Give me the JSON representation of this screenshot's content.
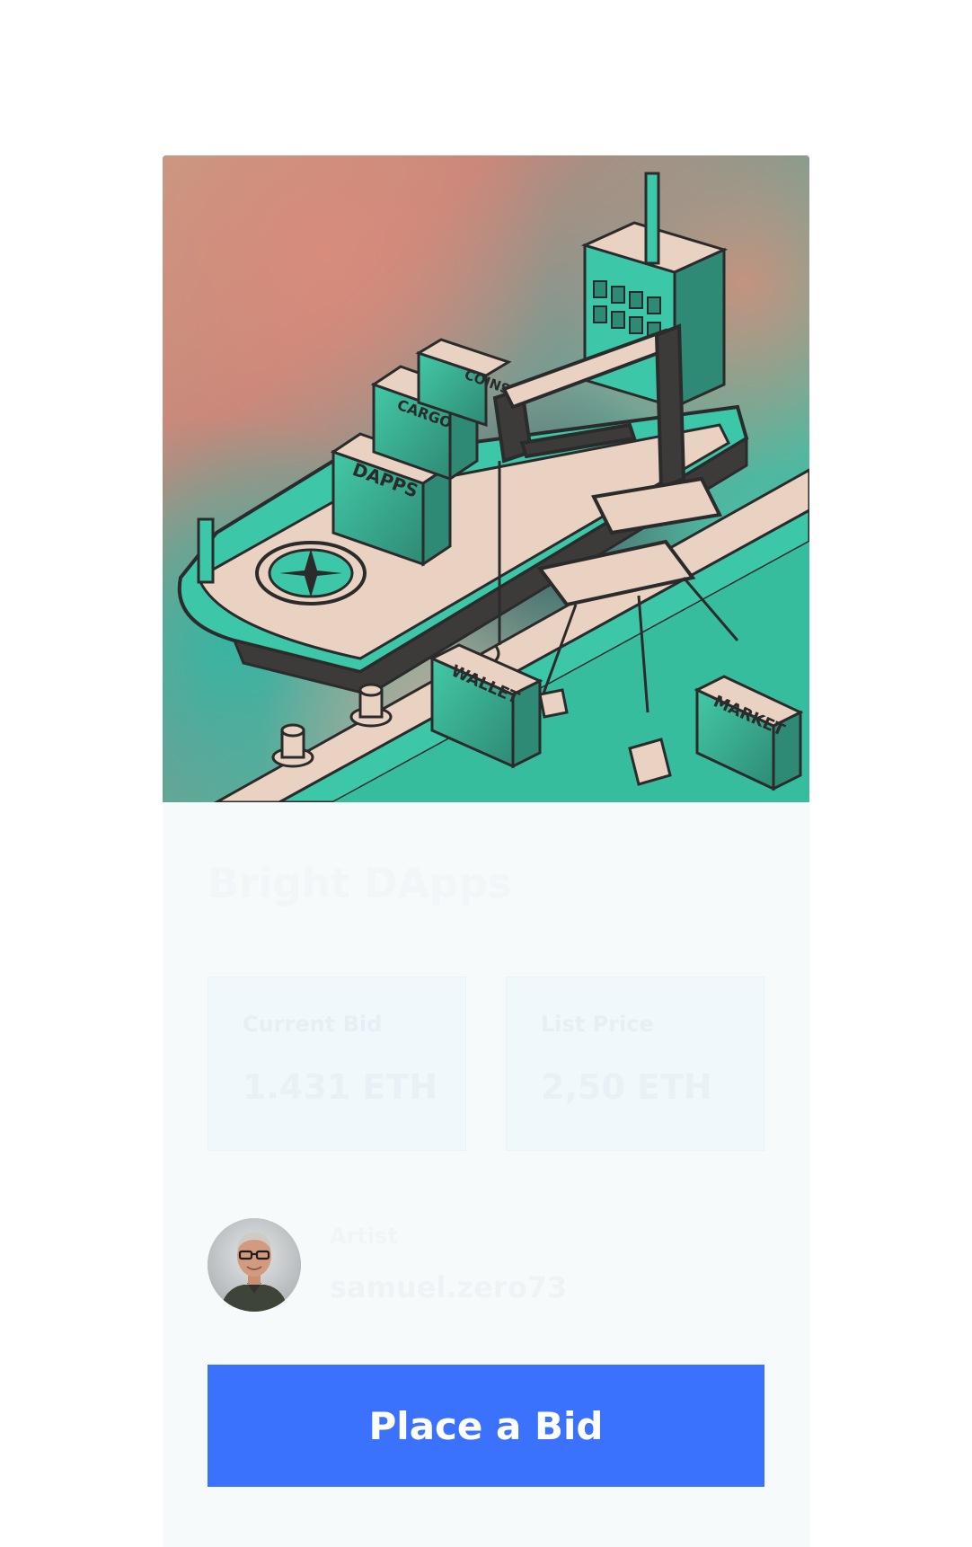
{
  "artwork": {
    "container_labels": [
      "COINS",
      "CARGO",
      "DAPPS",
      "WALLET",
      "MARKET"
    ],
    "colors": {
      "teal": "#3cc7a8",
      "dark": "#3d3a3a",
      "cream": "#e9d2c2",
      "pink": "#d98c7c"
    }
  },
  "item": {
    "title": "Bright DApps"
  },
  "stats": {
    "current_bid_label": "Current Bid",
    "current_bid_value": "1.431 ETH",
    "list_price_label": "List Price",
    "list_price_value": "2,50 ETH"
  },
  "artist": {
    "label": "Artist",
    "name": "samuel.zero73"
  },
  "actions": {
    "place_bid_label": "Place a Bid"
  },
  "theme": {
    "accent": "#3a72fe",
    "card_background": "#f7fafb"
  }
}
